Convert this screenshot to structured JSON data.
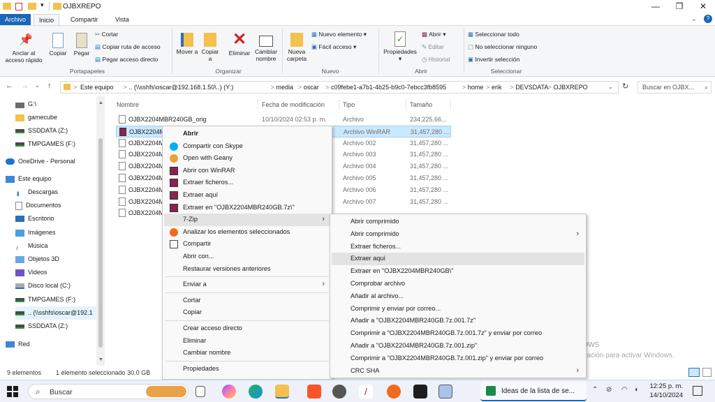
{
  "window": {
    "title": "OJBXREPO",
    "controls": {
      "minimize": "—",
      "maximize": "❐",
      "close": "✕"
    }
  },
  "ribbon_tabs": [
    "Archivo",
    "Inicio",
    "Compartir",
    "Vista"
  ],
  "ribbon": {
    "portapapeles": {
      "pin": "Anclar al acceso rápido",
      "copy": "Copiar",
      "paste": "Pegar",
      "cut": "Cortar",
      "copy_path": "Copiar ruta de acceso",
      "paste_shortcut": "Pegar acceso directo",
      "label": "Portapapeles"
    },
    "organizar": {
      "move": "Mover a",
      "copy_to": "Copiar a",
      "delete": "Eliminar",
      "rename": "Cambiar nombre",
      "label": "Organizar"
    },
    "nuevo": {
      "new_folder": "Nueva carpeta",
      "new_item": "Nuevo elemento",
      "easy_access": "Fácil acceso",
      "label": "Nuevo"
    },
    "abrir": {
      "properties": "Propiedades",
      "open": "Abrir",
      "edit": "Editar",
      "history": "Historial",
      "label": "Abrir"
    },
    "seleccionar": {
      "select_all": "Seleccionar todo",
      "select_none": "No seleccionar ninguno",
      "invert": "Invertir selección",
      "label": "Seleccionar"
    }
  },
  "address": {
    "crumbs": [
      "Este equipo",
      ">",
      ".. (\\\\sshfs\\oscar@192.168.1.50\\..) (Y:)",
      ">",
      "media",
      ">",
      "oscar",
      ">",
      "c09febe1-a7b1-4b25-b9c0-7ebcc3fb8595",
      ">",
      "home",
      ">",
      "erik",
      ">",
      "DEVSDATA",
      ">",
      "OJBXREPO"
    ],
    "search_placeholder": "Buscar en OJBX..."
  },
  "nav_items": [
    {
      "label": "G:\\",
      "icon": "drive-icon"
    },
    {
      "label": "gamecube",
      "icon": "folder-icon"
    },
    {
      "label": "SSDDATA (Z:)",
      "icon": "netdrive-icon"
    },
    {
      "label": "TMPGAMES (F:)",
      "icon": "netdrive-icon"
    },
    {
      "label": "OneDrive - Personal",
      "icon": "cloud-icon"
    },
    {
      "label": "Este equipo",
      "icon": "pc-icon"
    },
    {
      "label": "Descargas",
      "icon": "download-icon"
    },
    {
      "label": "Documentos",
      "icon": "document-icon"
    },
    {
      "label": "Escritorio",
      "icon": "desktop-icon"
    },
    {
      "label": "Imágenes",
      "icon": "pictures-icon"
    },
    {
      "label": "Música",
      "icon": "music-icon"
    },
    {
      "label": "Objetos 3D",
      "icon": "objects3d-icon"
    },
    {
      "label": "Videos",
      "icon": "videos-icon"
    },
    {
      "label": "Disco local (C:)",
      "icon": "disk-icon"
    },
    {
      "label": "TMPGAMES (F:)",
      "icon": "netdrive-icon"
    },
    {
      "label": ".. (\\\\sshfs\\oscar@192.1",
      "icon": "netdrive-icon"
    },
    {
      "label": "SSDDATA (Z:)",
      "icon": "netdrive-icon"
    },
    {
      "label": "Red",
      "icon": "network-icon"
    }
  ],
  "columns": [
    "Nombre",
    "Fecha de modificación",
    "Tipo",
    "Tamaño"
  ],
  "files": [
    {
      "name": "OJBX2204MBR240GB_orig",
      "date": "10/10/2024 02:53 p. m.",
      "type": "Archivo",
      "size": "234,225,66..."
    },
    {
      "name": "OJBX2204M",
      "date": "",
      "type": "Archivo WinRAR",
      "size": "31,457,280 ..."
    },
    {
      "name": "OJBX2204M",
      "date": "",
      "type": "Archivo 002",
      "size": "31,457,280 ..."
    },
    {
      "name": "OJBX2204M",
      "date": "",
      "type": "Archivo 003",
      "size": "31,457,280 ..."
    },
    {
      "name": "OJBX2204M",
      "date": "",
      "type": "Archivo 004",
      "size": "31,457,280 ..."
    },
    {
      "name": "OJBX2204M",
      "date": "",
      "type": "Archivo 005",
      "size": "31,457,280 ..."
    },
    {
      "name": "OJBX2204M",
      "date": "",
      "type": "Archivo 006",
      "size": "31,457,280 ..."
    },
    {
      "name": "OJBX2204M",
      "date": "",
      "type": "Archivo 007",
      "size": "31,457,280 ..."
    },
    {
      "name": "OJBX2204M",
      "date": "",
      "type": "",
      "size": ""
    }
  ],
  "context_menu": [
    {
      "label": "Abrir",
      "icon": "none",
      "bold": true
    },
    {
      "label": "Compartir con Skype",
      "icon": "skype-icon"
    },
    {
      "label": "Open with Geany",
      "icon": "geany-icon"
    },
    {
      "label": "Abrir con WinRAR",
      "icon": "winrar-icon"
    },
    {
      "label": "Extraer ficheros...",
      "icon": "winrar-icon"
    },
    {
      "label": "Extraer aquí",
      "icon": "winrar-icon"
    },
    {
      "label": "Extraer en \"OJBX2204MBR240GB.7z\\\"",
      "icon": "winrar-icon"
    },
    {
      "label": "7-Zip",
      "icon": "none",
      "submenu": true,
      "highlight": true
    },
    {
      "label": "Analizar los elementos seleccionados",
      "icon": "avast-icon"
    },
    {
      "label": "Compartir",
      "icon": "share-icon"
    },
    {
      "label": "Abrir con...",
      "icon": "none"
    },
    {
      "label": "Restaurar versiones anteriores",
      "icon": "none"
    },
    {
      "sep": true
    },
    {
      "label": "Enviar a",
      "icon": "none",
      "submenu": true
    },
    {
      "sep": true
    },
    {
      "label": "Cortar",
      "icon": "none"
    },
    {
      "label": "Copiar",
      "icon": "none"
    },
    {
      "sep": true
    },
    {
      "label": "Crear acceso directo",
      "icon": "none"
    },
    {
      "label": "Eliminar",
      "icon": "none"
    },
    {
      "label": "Cambiar nombre",
      "icon": "none"
    },
    {
      "sep": true
    },
    {
      "label": "Propiedades",
      "icon": "none"
    }
  ],
  "submenu_7zip": [
    {
      "label": "Abrir comprimido"
    },
    {
      "label": "Abrir comprimido",
      "submenu": true
    },
    {
      "label": "Extraer ficheros..."
    },
    {
      "label": "Extraer aquí",
      "highlight": true
    },
    {
      "label": "Extraer en \"OJBX2204MBR240GB\\\""
    },
    {
      "label": "Comprobar archivo"
    },
    {
      "label": "Añadir al archivo..."
    },
    {
      "label": "Comprimir y enviar por correo..."
    },
    {
      "label": "Añadir a \"OJBX2204MBR240GB.7z.001.7z\""
    },
    {
      "label": "Comprimir a \"OJBX2204MBR240GB.7z.001.7z\" y enviar por correo"
    },
    {
      "label": "Añadir a \"OJBX2204MBR240GB.7z.001.zip\""
    },
    {
      "label": "Comprimir a \"OJBX2204MBR240GB.7z.001.zip\" y enviar por correo"
    },
    {
      "label": "CRC SHA",
      "submenu": true
    }
  ],
  "status": {
    "count": "9 elementos",
    "selected": "1 elemento seleccionado  30.0 GB"
  },
  "watermark": {
    "line1": "Activar Windows",
    "line2": "Ve a Configuración para activar Windows."
  },
  "taskbar": {
    "search": "Buscar",
    "active_app": "Ideas de la lista de se...",
    "time": "12:25 p. m.",
    "date": "14/10/2024"
  },
  "colors": {
    "accent": "#1a66b8",
    "selection": "#cce8ff",
    "folder": "#f4c04e"
  }
}
